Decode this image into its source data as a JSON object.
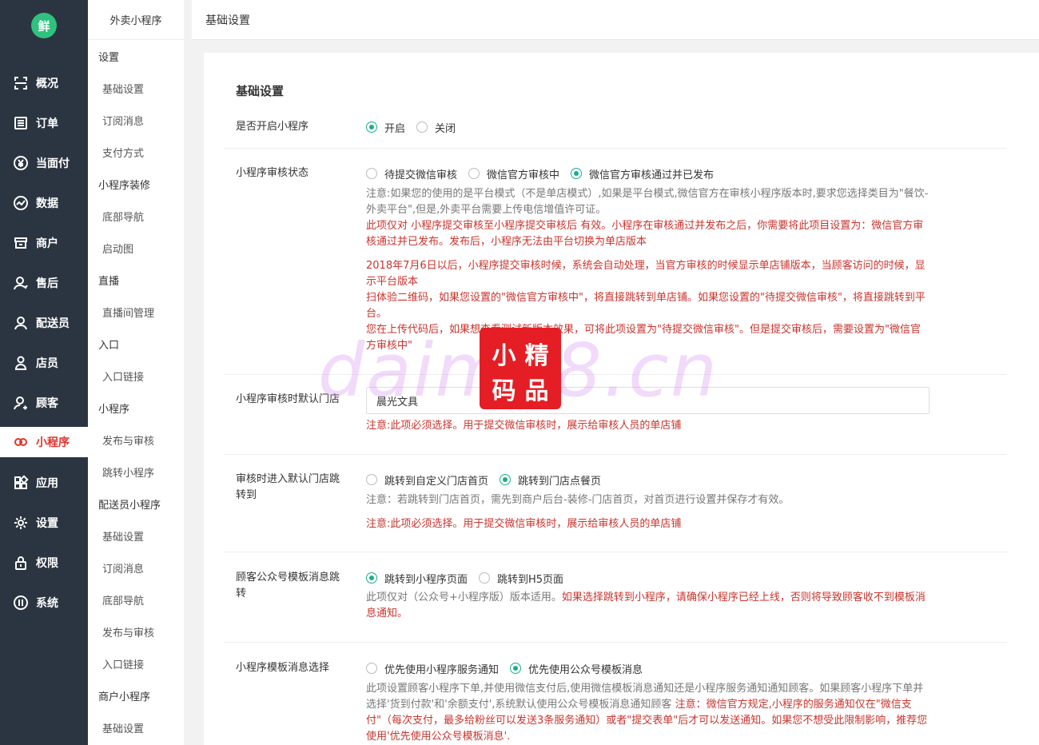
{
  "nav": {
    "logo": "鲜",
    "items": [
      {
        "label": "概况",
        "icon": "overview-icon"
      },
      {
        "label": "订单",
        "icon": "order-icon"
      },
      {
        "label": "当面付",
        "icon": "yen-icon"
      },
      {
        "label": "数据",
        "icon": "chart-icon"
      },
      {
        "label": "商户",
        "icon": "store-icon"
      },
      {
        "label": "售后",
        "icon": "aftersale-icon"
      },
      {
        "label": "配送员",
        "icon": "courier-icon"
      },
      {
        "label": "店员",
        "icon": "clerk-icon"
      },
      {
        "label": "顾客",
        "icon": "customer-icon"
      },
      {
        "label": "小程序",
        "icon": "miniprogram-icon"
      },
      {
        "label": "应用",
        "icon": "apps-icon"
      },
      {
        "label": "设置",
        "icon": "gear-icon"
      },
      {
        "label": "权限",
        "icon": "lock-icon"
      },
      {
        "label": "系统",
        "icon": "system-icon"
      }
    ],
    "active_index": 9
  },
  "subnav": {
    "title": "外卖小程序",
    "groups": [
      {
        "label": "设置"
      },
      {
        "label": "基础设置"
      },
      {
        "label": "订阅消息"
      },
      {
        "label": "支付方式"
      },
      {
        "label": "小程序装修"
      },
      {
        "label": "底部导航"
      },
      {
        "label": "启动图"
      },
      {
        "label": "直播"
      },
      {
        "label": "直播间管理"
      },
      {
        "label": "入口"
      },
      {
        "label": "入口链接"
      },
      {
        "label": "小程序"
      },
      {
        "label": "发布与审核"
      },
      {
        "label": "跳转小程序"
      },
      {
        "label": "配送员小程序"
      },
      {
        "label": "基础设置"
      },
      {
        "label": "订阅消息"
      },
      {
        "label": "底部导航"
      },
      {
        "label": "发布与审核"
      },
      {
        "label": "入口链接"
      },
      {
        "label": "商户小程序"
      },
      {
        "label": "基础设置"
      }
    ]
  },
  "topbar": {
    "title": "基础设置"
  },
  "form": {
    "section_title": "基础设置",
    "enable": {
      "label": "是否开启小程序",
      "options": [
        "开启",
        "关闭"
      ]
    },
    "audit_status": {
      "label": "小程序审核状态",
      "options": [
        "待提交微信审核",
        "微信官方审核中",
        "微信官方审核通过并已发布"
      ],
      "note_gray": "注意:如果您的使用的是平台模式（不是单店模式）,如果是平台模式,微信官方在审核小程序版本时,要求您选择类目为\"餐饮-外卖平台\",但是,外卖平台需要上传电信增值许可证。",
      "note_red1": "此项仅对 小程序提交审核至小程序提交审核后 有效。小程序在审核通过并发布之后，你需要将此项目设置为：微信官方审核通过并已发布。发布后，小程序无法由平台切换为单店版本",
      "note_red2": "2018年7月6日以后，小程序提交审核时候，系统会自动处理，当官方审核的时候显示单店铺版本，当顾客访问的时候，显示平台版本",
      "note_red3": "扫体验二维码，如果您设置的\"微信官方审核中\"，将直接跳转到单店铺。如果您设置的\"待提交微信审核\"，将直接跳转到平台。",
      "note_red4": "您在上传代码后，如果想查看测试新版本效果，可将此项设置为\"待提交微信审核\"。但是提交审核后，需要设置为\"微信官方审核中\""
    },
    "default_store": {
      "label": "小程序审核时默认门店",
      "value": "晨光文具",
      "note": "注意:此项必须选择。用于提交微信审核时，展示给审核人员的单店铺"
    },
    "jump_to": {
      "label": "审核时进入默认门店跳转到",
      "options": [
        "跳转到自定义门店首页",
        "跳转到门店点餐页"
      ],
      "note_gray": "注意：若跳转到门店首页，需先到商户后台-装修-门店首页，对首页进行设置并保存才有效。",
      "note_red": "注意:此项必须选择。用于提交微信审核时，展示给审核人员的单店铺"
    },
    "template_jump": {
      "label": "顾客公众号模板消息跳转",
      "options": [
        "跳转到小程序页面",
        "跳转到H5页面"
      ],
      "note_gray": "此项仅对（公众号+小程序版）版本适用。",
      "note_red": "如果选择跳转到小程序，请确保小程序已经上线，否则将导致顾客收不到模板消息通知。"
    },
    "template_choice": {
      "label": "小程序模板消息选择",
      "options": [
        "优先使用小程序服务通知",
        "优先使用公众号模板消息"
      ],
      "note_gray": "此项设置顾客小程序下单,并使用微信支付后,使用微信模板消息通知还是小程序服务通知通知顾客。如果顾客小程序下单并选择'货到付款'和'余额支付',系统默认使用公众号模板消息通知顾客",
      "note_red": "注意：微信官方规定,小程序的服务通知仅在\"微信支付\"（每次支付，最多给粉丝可以发送3条服务通知）或者\"提交表单\"后才可以发送通知。如果您不想受此限制影响，推荐您使用'优先使用公众号模板消息'."
    }
  },
  "watermark": {
    "text": "daima8.cn",
    "seal": [
      "小",
      "精",
      "码",
      "品"
    ]
  },
  "colors": {
    "accent": "#1aad8f",
    "nav_bg": "#2b3541",
    "warning": "#c9342d"
  }
}
